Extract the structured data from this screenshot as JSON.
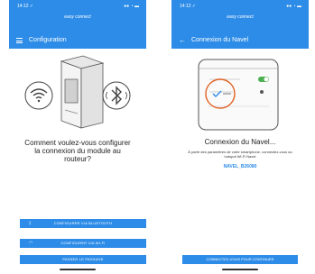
{
  "colors": {
    "accent": "#2d8ce8"
  },
  "left_screen": {
    "status_time": "14:12 ✓",
    "status_icons": "●● ◔ ▬",
    "brand": "easy connect",
    "title": "Configuration",
    "question": "Comment voulez-vous configurer la connexion du module au routeur?",
    "buttons": [
      {
        "label": "CONFIGURER VIA BLUETOOTH",
        "icon": "bluetooth-icon"
      },
      {
        "label": "CONFIGURER VIA WI-FI",
        "icon": "wifi-icon"
      },
      {
        "label": "PASSER LE PASSAGE"
      }
    ]
  },
  "right_screen": {
    "status_time": "14:12 ✓",
    "status_icons": "●● ◔ ▬",
    "brand": "easy connect",
    "title": "Connexion du Navel",
    "heading": "Connexion du Navel...",
    "description": "À partir des paramètres de votre smartphone, connectez-vous au hotspot Wi-Fi Navel",
    "hotspot_name": "NAVEL_B26080",
    "cta": "CONNECTEZ-VOUS POUR CONTINUER"
  }
}
